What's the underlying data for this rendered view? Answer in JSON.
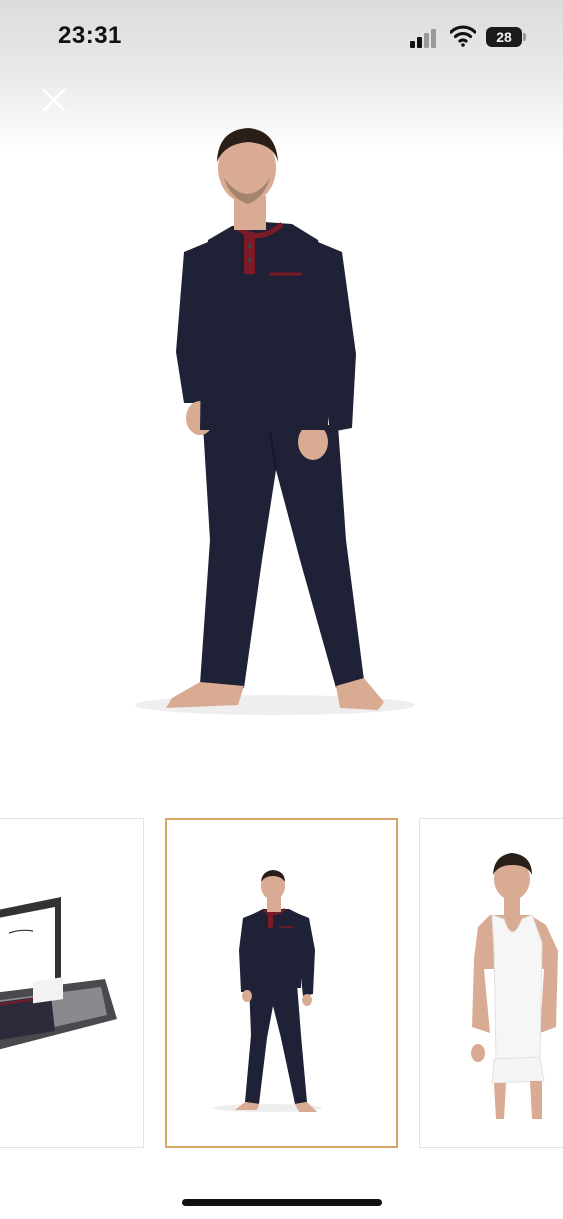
{
  "status_bar": {
    "time": "23:31",
    "battery_level": "28",
    "signal_bars_active": 2,
    "icons": [
      "cellular-signal-icon",
      "wifi-icon",
      "battery-icon"
    ]
  },
  "viewer": {
    "close_icon": "close-icon",
    "hero_image": "model-in-navy-pajama-set",
    "selected_thumbnail_index": 1
  },
  "thumbnails": [
    {
      "subject": "gift-box-set"
    },
    {
      "subject": "navy-pajama-set"
    },
    {
      "subject": "white-tank-top-set"
    }
  ],
  "colors": {
    "selected_border": "#d7a665",
    "garment_navy": "#1f2236",
    "garment_trim": "#7d1a27"
  }
}
